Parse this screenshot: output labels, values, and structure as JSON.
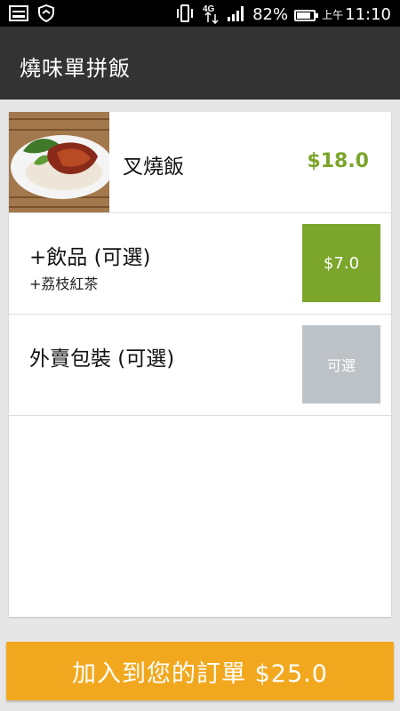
{
  "status_bar": {
    "network_type": "4G",
    "battery_percent": "82%",
    "battery_level": 0.82,
    "time_prefix": "上午",
    "time": "11:10",
    "icons": [
      "image-icon",
      "shield-icon",
      "vibrate-icon",
      "network-4g-icon",
      "signal-icon",
      "battery-icon"
    ]
  },
  "app_bar": {
    "title": "燒味單拼飯"
  },
  "main_item": {
    "name": "叉燒飯",
    "price": "$18.0",
    "image": "char-siu-rice-photo"
  },
  "drink_option": {
    "title": "+飲品 (可選)",
    "selected": "+荔枝紅茶",
    "button_label": "$7.0"
  },
  "packaging_option": {
    "title": "外賣包裝 (可選)",
    "button_label": "可選"
  },
  "cta": {
    "label": "加入到您的訂單 $25.0"
  },
  "colors": {
    "app_bar": "#333333",
    "price_green": "#7ba52b",
    "optional_gray": "#bdc2c7",
    "cta_orange": "#f2a81e",
    "background": "#e6e6e6"
  }
}
